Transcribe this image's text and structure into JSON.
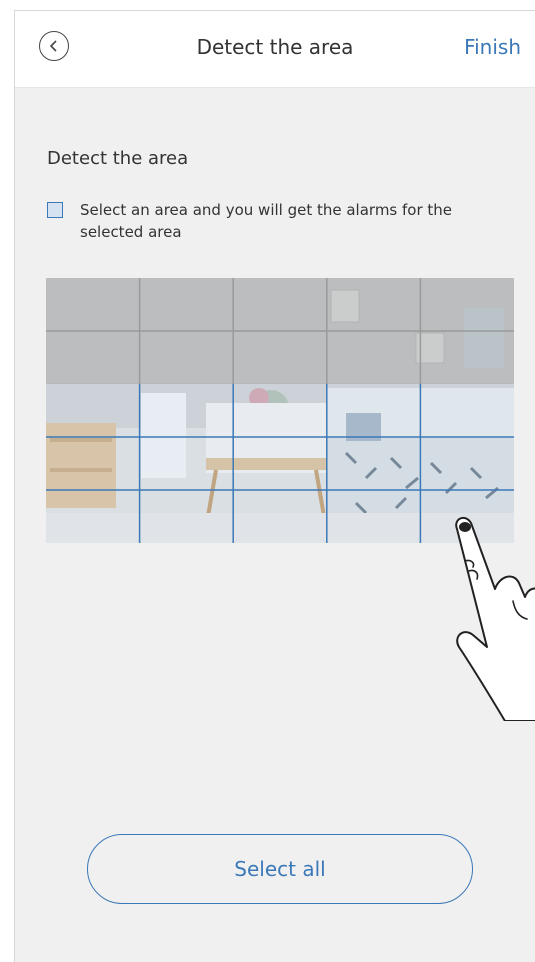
{
  "header": {
    "title": "Detect the area",
    "finish_label": "Finish",
    "back_icon": "chevron-left-icon"
  },
  "section": {
    "title": "Detect the area",
    "checkbox_label": "Select an area and you will get the alarms for the selected area",
    "checkbox_checked": false
  },
  "grid": {
    "columns": 5,
    "rows": 5,
    "selected_rows": [
      3,
      4,
      5
    ]
  },
  "colors": {
    "accent": "#3b78b8",
    "background": "#f0f0f0",
    "text": "#333333"
  },
  "footer": {
    "select_all_label": "Select all"
  }
}
